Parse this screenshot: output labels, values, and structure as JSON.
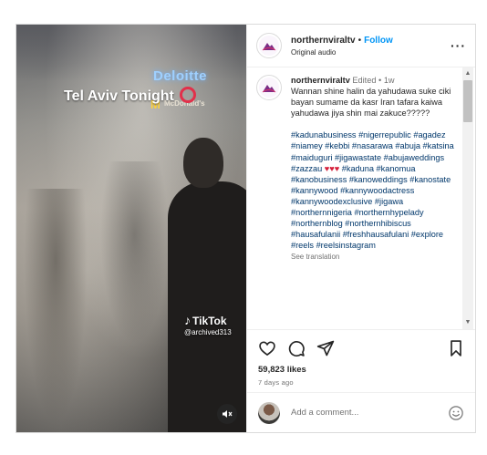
{
  "media": {
    "overlay_title": "Tel Aviv Tonight",
    "sign_deloitte": "Deloitte",
    "sign_mcd_logo": "M",
    "sign_mcd_text": "McDonald's",
    "tiktok_label": "TikTok",
    "tiktok_handle": "@archived313",
    "mute_icon": "speaker-muted-icon"
  },
  "header": {
    "username": "northernviraltv",
    "separator": "•",
    "follow_label": "Follow",
    "audio": "Original audio",
    "more_icon": "more-options-icon"
  },
  "caption": {
    "username": "northernviraltv",
    "edited": "Edited",
    "separator": "•",
    "age": "1w",
    "text": "Wannan shine halin da yahudawa suke ciki bayan sumame da kasr Iran tafara kaiwa yahudawa jiya shin mai zakuce?????",
    "tags_part1": "#kadunabusiness #nigerrepublic #agadez #niamey #kebbi #nasarawa #abuja #katsina #maiduguri #jigawastate #abujaweddings #zazzau",
    "hearts": "♥♥♥",
    "tags_part2": "#kaduna #kanomua #kanobusiness #kanoweddings #kanostate #kannywood #kannywoodactress #kannywoodexclusive #jigawa #northernnigeria #northernhypelady #northernblog #northernhibiscus #hausafulanii #freshhausafulani #explore #reels #reelsinstagram",
    "see_translation": "See translation"
  },
  "actions": {
    "likes": "59,823 likes",
    "time": "7 days ago"
  },
  "comment_box": {
    "placeholder": "Add a comment..."
  },
  "colors": {
    "follow_blue": "#0095f6",
    "hashtag_blue": "#00376b",
    "heart_red": "#d51f3a",
    "badge_red": "#e2304a"
  }
}
